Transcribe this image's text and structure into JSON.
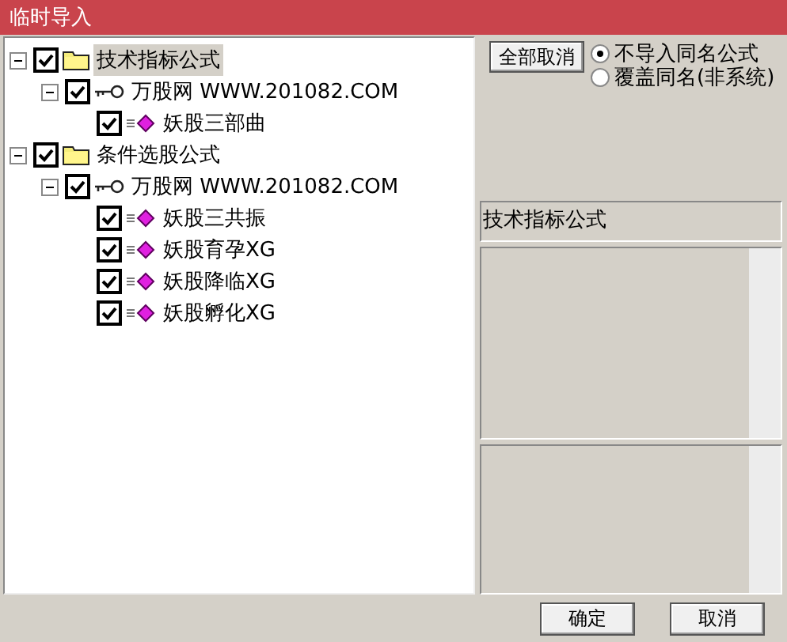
{
  "window": {
    "title": "临时导入"
  },
  "tree": [
    {
      "kind": "folder",
      "label": "技术指标公式",
      "checked": true,
      "expanded": true,
      "selected": true,
      "children": [
        {
          "kind": "source",
          "label": "万股网 WWW.201082.COM",
          "checked": true,
          "expanded": true,
          "selected": false,
          "children": [
            {
              "kind": "formula",
              "label": "妖股三部曲",
              "checked": true,
              "selected": false
            }
          ]
        }
      ]
    },
    {
      "kind": "folder",
      "label": "条件选股公式",
      "checked": true,
      "expanded": true,
      "selected": false,
      "children": [
        {
          "kind": "source",
          "label": "万股网 WWW.201082.COM",
          "checked": true,
          "expanded": true,
          "selected": false,
          "children": [
            {
              "kind": "formula",
              "label": "妖股三共振",
              "checked": true,
              "selected": false
            },
            {
              "kind": "formula",
              "label": "妖股育孕XG",
              "checked": true,
              "selected": false
            },
            {
              "kind": "formula",
              "label": "妖股降临XG",
              "checked": true,
              "selected": false
            },
            {
              "kind": "formula",
              "label": "妖股孵化XG",
              "checked": true,
              "selected": false
            }
          ]
        }
      ]
    }
  ],
  "clear_all_button": "全部取消",
  "options": [
    {
      "label": "不导入同名公式",
      "selected": true
    },
    {
      "label": "覆盖同名(非系统)",
      "selected": false
    }
  ],
  "category_field": "技术指标公式",
  "buttons": [
    "确定",
    "取消"
  ]
}
